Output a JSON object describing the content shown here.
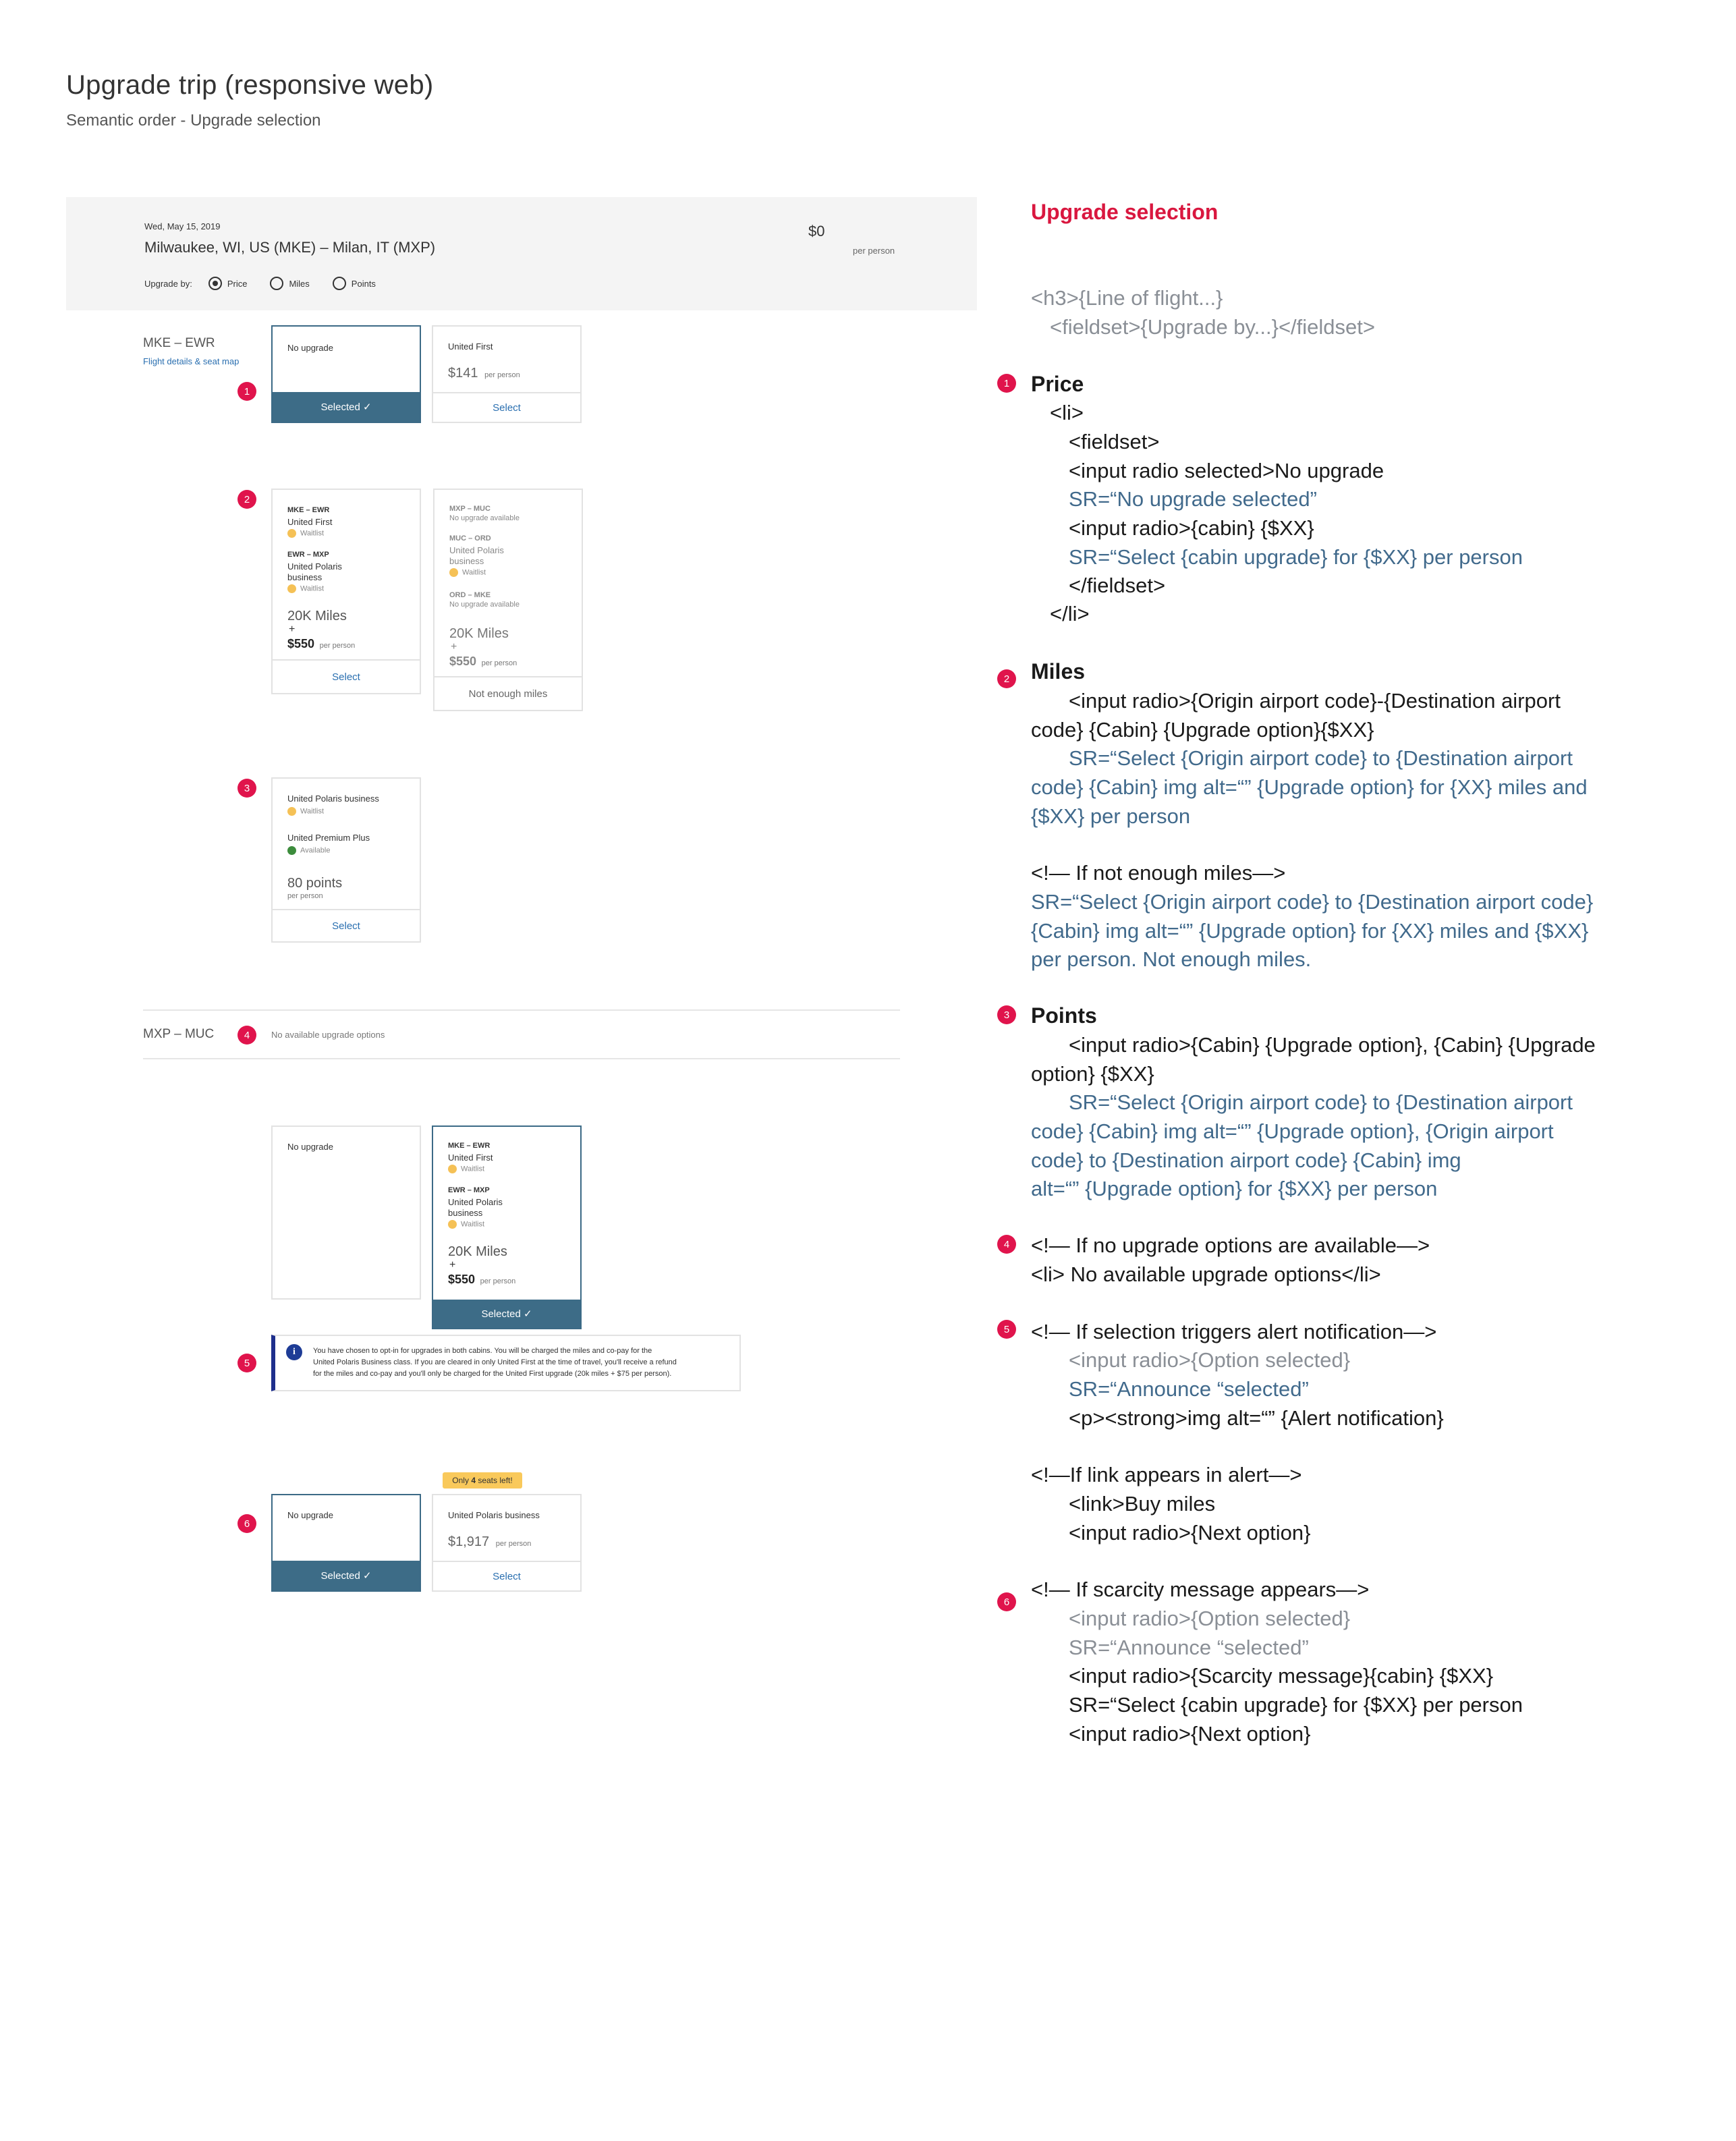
{
  "page": {
    "title": "Upgrade trip (responsive web)",
    "subtitle": "Semantic order - Upgrade selection"
  },
  "trip": {
    "date": "Wed, May 15, 2019",
    "route": "Milwaukee, WI, US (MKE)  –  Milan, IT (MXP)",
    "price": "$0",
    "per_person": "per person",
    "upgrade_by_label": "Upgrade by:",
    "options": [
      {
        "label": "Price",
        "selected": true
      },
      {
        "label": "Miles",
        "selected": false
      },
      {
        "label": "Points",
        "selected": false
      }
    ]
  },
  "segment1": {
    "label": "MKE – EWR",
    "link": "Flight details & seat map"
  },
  "price_cards": {
    "no_upgrade": "No upgrade",
    "selected_label": "Selected ✓",
    "first_title": "United First",
    "first_price": "$141",
    "per_person": "per person",
    "select": "Select"
  },
  "miles_cards": {
    "a": {
      "leg1_code": "MKE – EWR",
      "leg1_cabin": "United First",
      "leg1_status": "Waitlist",
      "leg2_code": "EWR – MXP",
      "leg2_cabin": "United Polaris",
      "leg2_cabin2": "business",
      "leg2_status": "Waitlist",
      "miles": "20K Miles",
      "plus": "+",
      "price": "$550",
      "per_person": "per person",
      "select": "Select"
    },
    "b": {
      "leg1_code": "MXP – MUC",
      "leg1_status": "No upgrade available",
      "leg2_code": "MUC – ORD",
      "leg2_cabin": "United Polaris",
      "leg2_cabin2": "business",
      "leg2_status": "Waitlist",
      "leg3_code": "ORD – MKE",
      "leg3_status": "No upgrade available",
      "miles": "20K Miles",
      "plus": "+",
      "price": "$550",
      "per_person": "per person",
      "footer": "Not enough miles"
    }
  },
  "points_card": {
    "cabin1": "United Polaris business",
    "cabin1_status": "Waitlist",
    "cabin2": "United Premium Plus",
    "cabin2_status": "Available",
    "points": "80 points",
    "per_person": "per person",
    "select": "Select"
  },
  "segment2": {
    "label": "MXP – MUC",
    "message": "No available upgrade options"
  },
  "alert_cards": {
    "no_upgrade": "No upgrade",
    "leg1_code": "MKE – EWR",
    "leg1_cabin": "United First",
    "leg1_status": "Waitlist",
    "leg2_code": "EWR – MXP",
    "leg2_cabin": "United Polaris",
    "leg2_cabin2": "business",
    "leg2_status": "Waitlist",
    "miles": "20K Miles",
    "plus": "+",
    "price": "$550",
    "per_person": "per person",
    "selected_label": "Selected ✓",
    "alert_line1": "You have chosen to opt-in for upgrades in both cabins. You will be charged the miles and co-pay for the",
    "alert_line2": "United Polaris Business class. If you are cleared in only United First at the time of travel, you'll receive a refund",
    "alert_line3": "for the miles and co-pay and you'll only be charged for the United First upgrade (20k miles + $75 per person)."
  },
  "scarcity_cards": {
    "badge_pre": "Only ",
    "badge_num": "4",
    "badge_post": " seats left!",
    "no_upgrade": "No upgrade",
    "selected_label": "Selected ✓",
    "cabin": "United Polaris business",
    "price": "$1,917",
    "per_person": "per person",
    "select": "Select"
  },
  "badges": [
    "1",
    "2",
    "3",
    "4",
    "5",
    "6"
  ],
  "notes": {
    "title": "Upgrade selection",
    "intro1": "<h3>{Line of flight...}",
    "intro2": "<fieldset>{Upgrade by...}</fieldset>",
    "s1_head": "Price",
    "s1_l1": "<li>",
    "s1_l2": "<fieldset>",
    "s1_l3": "<input radio selected>No upgrade",
    "s1_l4": "SR=“No upgrade selected”",
    "s1_l5": "<input radio>{cabin} {$XX}",
    "s1_l6": "SR=“Select {cabin upgrade} for {$XX} per person",
    "s1_l7": "</fieldset>",
    "s1_l8": "</li>",
    "s2_head": "Miles",
    "s2_l1": "<input radio>{Origin airport code}-{Destination airport",
    "s2_l2": "code} {Cabin} {Upgrade option}{$XX}",
    "s2_l3": "SR=“Select {Origin airport code} to {Destination airport",
    "s2_l4": "code} {Cabin} img alt=“” {Upgrade option} for {XX} miles and",
    "s2_l5": "{$XX}  per person",
    "s2_l6": "<!— If not enough miles—>",
    "s2_l7": "SR=“Select {Origin airport code} to {Destination airport code}",
    "s2_l8": "{Cabin} img alt=“” {Upgrade option} for {XX} miles and {$XX}",
    "s2_l9": "per person. Not enough miles.",
    "s3_head": "Points",
    "s3_l1": "<input radio>{Cabin} {Upgrade option}, {Cabin} {Upgrade",
    "s3_l2": "option} {$XX}",
    "s3_l3": "SR=“Select {Origin airport code} to {Destination airport",
    "s3_l4": "code} {Cabin} img alt=“” {Upgrade option}, {Origin airport",
    "s3_l5": "code} to {Destination airport code} {Cabin} img",
    "s3_l6": "alt=“” {Upgrade option} for {$XX}  per person",
    "s4_l1": "<!— If no upgrade options are available—>",
    "s4_l2": "<li> No available upgrade options</li>",
    "s5_l1": "<!— If selection triggers alert notification—>",
    "s5_l2": "<input radio>{Option selected}",
    "s5_l3": "SR=“Announce “selected”",
    "s5_l4": "<p><strong>img alt=“” {Alert notification}",
    "s5_l5": "<!—If  link appears in alert—>",
    "s5_l6": "<link>Buy miles",
    "s5_l7": "<input radio>{Next option}",
    "s6_l1": "<!— If scarcity message appears—>",
    "s6_l2": "<input radio>{Option selected}",
    "s6_l3": "SR=“Announce “selected”",
    "s6_l4": "<input radio>{Scarcity message}{cabin} {$XX}",
    "s6_l5": "SR=“Select {cabin upgrade} for {$XX} per person",
    "s6_l6": "<input radio>{Next option}"
  },
  "colors": {
    "accent": "#e0144c",
    "selected_bg": "#3d6c87",
    "link": "#2a6fb0",
    "sr_text": "#416a8c",
    "scarcity": "#f9c95b",
    "alert_bar": "#1e2f8c"
  }
}
